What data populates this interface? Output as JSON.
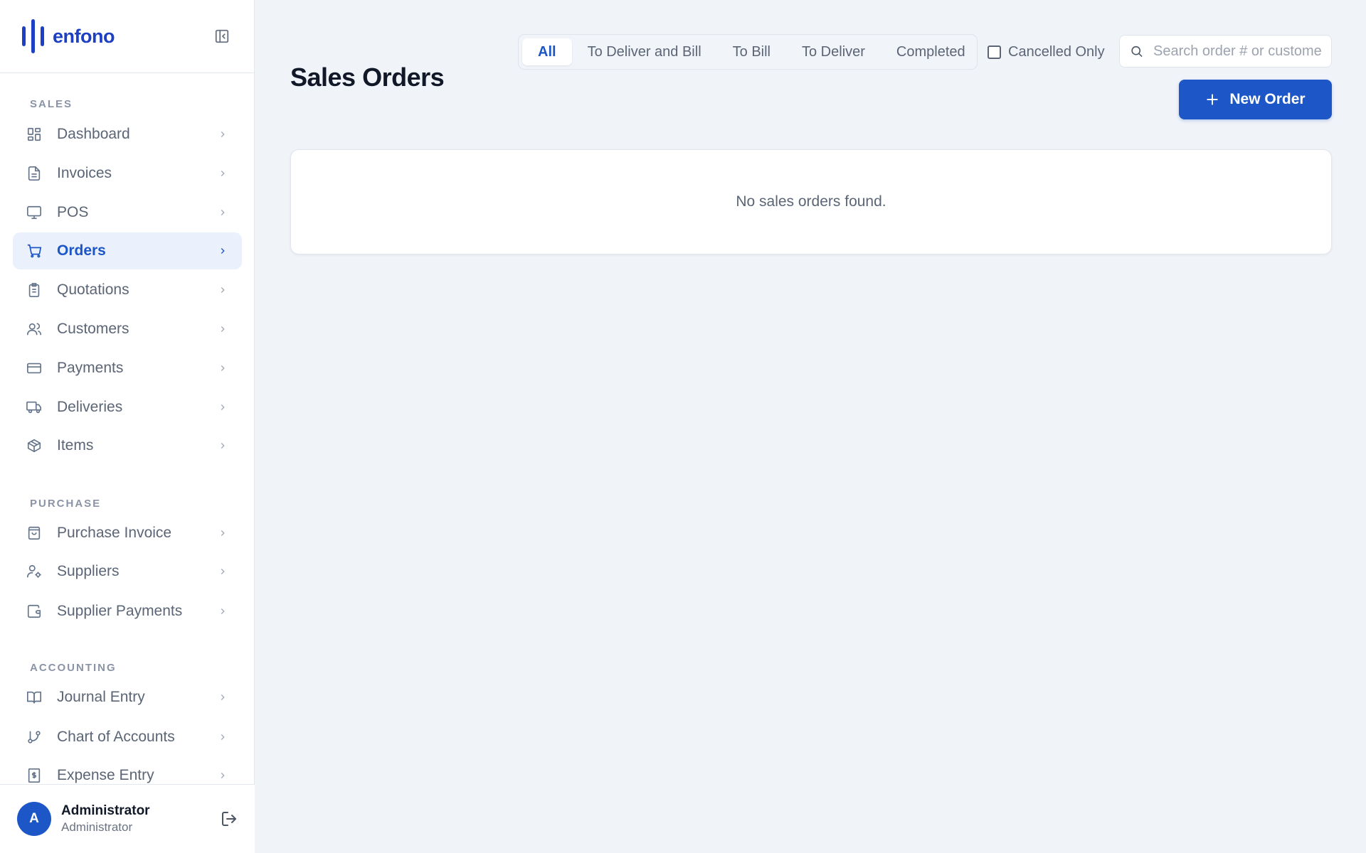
{
  "brand": {
    "name": "enfono",
    "color": "#1d3fc4"
  },
  "sidebar": {
    "sections": [
      {
        "label": "SALES"
      },
      {
        "label": "PURCHASE"
      },
      {
        "label": "ACCOUNTING"
      }
    ],
    "items": [
      {
        "label": "Dashboard",
        "icon": "dashboard-icon"
      },
      {
        "label": "Invoices",
        "icon": "document-icon"
      },
      {
        "label": "POS",
        "icon": "monitor-icon"
      },
      {
        "label": "Orders",
        "icon": "cart-icon",
        "active": true
      },
      {
        "label": "Quotations",
        "icon": "clipboard-icon"
      },
      {
        "label": "Customers",
        "icon": "users-icon"
      },
      {
        "label": "Payments",
        "icon": "credit-card-icon"
      },
      {
        "label": "Deliveries",
        "icon": "truck-icon"
      },
      {
        "label": "Items",
        "icon": "package-icon"
      },
      {
        "label": "Purchase Invoice",
        "icon": "shopping-bag-icon"
      },
      {
        "label": "Suppliers",
        "icon": "user-cog-icon"
      },
      {
        "label": "Supplier Payments",
        "icon": "wallet-icon"
      },
      {
        "label": "Journal Entry",
        "icon": "book-icon"
      },
      {
        "label": "Chart of Accounts",
        "icon": "git-branch-icon"
      },
      {
        "label": "Expense Entry",
        "icon": "receipt-icon"
      }
    ]
  },
  "user": {
    "initial": "A",
    "name": "Administrator",
    "role": "Administrator"
  },
  "main": {
    "title": "Sales Orders",
    "tabs": [
      {
        "label": "All",
        "active": true
      },
      {
        "label": "To Deliver and Bill"
      },
      {
        "label": "To Bill"
      },
      {
        "label": "To Deliver"
      },
      {
        "label": "Completed"
      }
    ],
    "cancelled_only_label": "Cancelled Only",
    "search": {
      "placeholder": "Search order # or customer...",
      "value": ""
    },
    "new_order_label": "New Order",
    "empty_message": "No sales orders found."
  },
  "colors": {
    "accent": "#1d56c6",
    "active_bg": "#eaf1fd",
    "page_bg": "#f0f3f8"
  }
}
